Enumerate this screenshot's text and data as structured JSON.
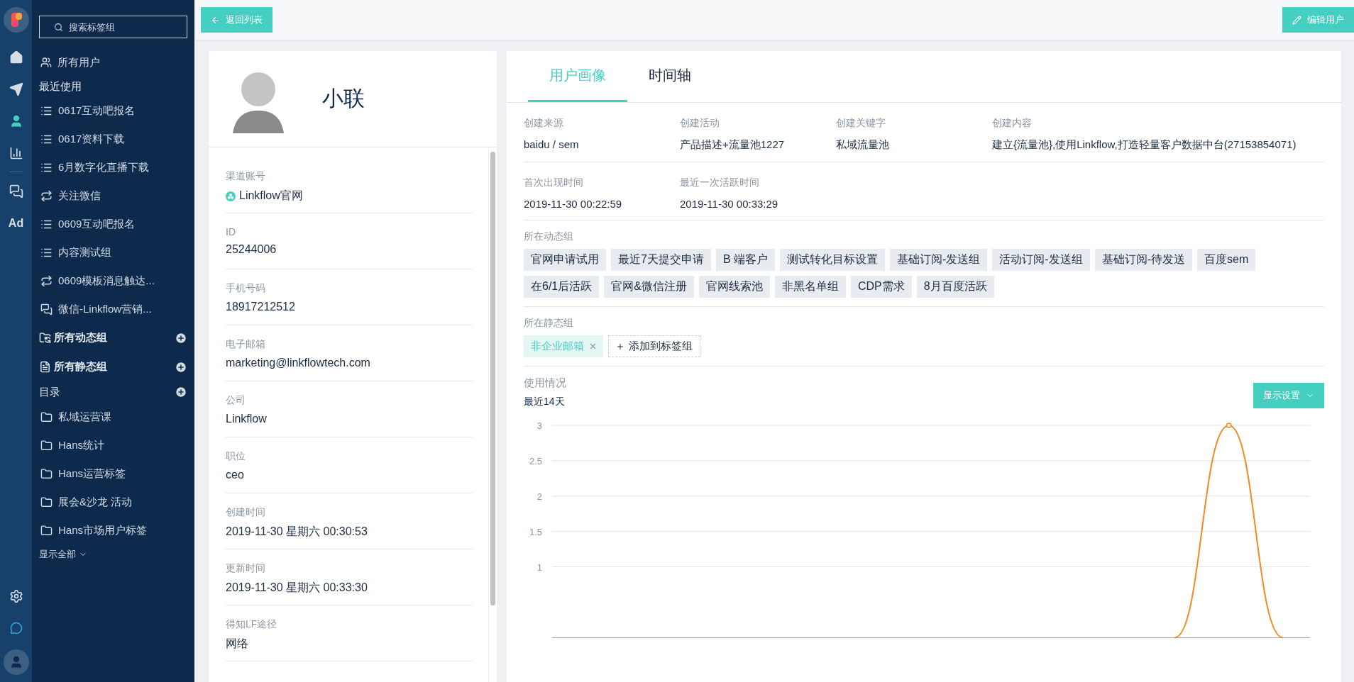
{
  "rail": [
    {
      "kind": "home",
      "selected": false
    },
    {
      "kind": "send",
      "selected": false
    },
    {
      "kind": "user",
      "selected": true
    },
    {
      "kind": "chart",
      "selected": false
    },
    {
      "kind": "wechat",
      "selected": false
    },
    {
      "kind": "ad",
      "label": "Ad",
      "selected": false
    }
  ],
  "rail_bottom": [
    {
      "kind": "settings"
    },
    {
      "kind": "chat"
    },
    {
      "kind": "avatar"
    }
  ],
  "nav": {
    "search": {
      "placeholder": "搜索标签组"
    },
    "all_users": "所有用户",
    "recent_title": "最近使用",
    "recent": [
      {
        "label": "0617互动吧报名",
        "kind": "list"
      },
      {
        "label": "0617资料下载",
        "kind": "list"
      },
      {
        "label": "6月数字化直播下载",
        "kind": "list"
      },
      {
        "label": "关注微信",
        "kind": "sync"
      },
      {
        "label": "0609互动吧报名",
        "kind": "list"
      },
      {
        "label": "内容测试组",
        "kind": "list"
      },
      {
        "label": "0609模板消息触达...",
        "kind": "sync"
      },
      {
        "label": "微信-Linkflow营销...",
        "kind": "wechat"
      }
    ],
    "groups": [
      {
        "label": "所有动态组",
        "kind": "dynamic"
      },
      {
        "label": "所有静态组",
        "kind": "static"
      }
    ],
    "catalog_title": "目录",
    "catalog": [
      "私域运营课",
      "Hans统计",
      "Hans运营标签",
      "展会&沙龙 活动",
      "Hans市场用户标签"
    ],
    "show_all": "显示全部"
  },
  "toolbar": {
    "back": "返回列表",
    "edit": "编辑用户"
  },
  "profile": {
    "name": "小联",
    "fields": [
      {
        "label": "渠道账号",
        "value": "Linkflow官网",
        "kind": "channel"
      },
      {
        "label": "ID",
        "value": "25244006",
        "kind": "text"
      },
      {
        "label": "手机号码",
        "value": "18917212512",
        "kind": "text"
      },
      {
        "label": "电子邮箱",
        "value": "marketing@linkflowtech.com",
        "kind": "text"
      },
      {
        "label": "公司",
        "value": "Linkflow",
        "kind": "text"
      },
      {
        "label": "职位",
        "value": "ceo",
        "kind": "text"
      },
      {
        "label": "创建时间",
        "value": "2019-11-30 星期六 00:30:53",
        "kind": "text"
      },
      {
        "label": "更新时间",
        "value": "2019-11-30 星期六 00:33:30",
        "kind": "text"
      },
      {
        "label": "得知LF途径",
        "value": "网络",
        "kind": "text"
      }
    ]
  },
  "tabs": [
    {
      "label": "用户画像",
      "selected": true
    },
    {
      "label": "时间轴",
      "selected": false
    }
  ],
  "info_rows": [
    [
      {
        "label": "创建来源",
        "value": "baidu / sem"
      },
      {
        "label": "创建活动",
        "value": "产品描述+流量池1227"
      },
      {
        "label": "创建关键字",
        "value": "私域流量池"
      },
      {
        "label": "创建内容",
        "value": "建立{流量池},使用Linkflow,打造轻量客户数据中台(27153854071)"
      }
    ],
    [
      {
        "label": "首次出现时间",
        "value": "2019-11-30 00:22:59"
      },
      {
        "label": "最近一次活跃时间",
        "value": "2019-11-30 00:33:29"
      }
    ]
  ],
  "dynamic_groups": {
    "title": "所在动态组",
    "tags": [
      "官网申请试用",
      "最近7天提交申请",
      "B 端客户",
      "测试转化目标设置",
      "基础订阅-发送组",
      "活动订阅-发送组",
      "基础订阅-待发送",
      "百度sem",
      "在6/1后活跃",
      "官网&微信注册",
      "官网线索池",
      "非黑名单组",
      "CDP需求",
      "8月百度活跃"
    ]
  },
  "static_groups": {
    "title": "所在静态组",
    "tags": [
      {
        "label": "非企业邮箱",
        "removable": true
      }
    ],
    "add": "添加到标签组"
  },
  "usage": {
    "title": "使用情况",
    "subtitle": "最近14天",
    "settings_button": "显示设置",
    "chart_data": {
      "type": "line",
      "series": [
        {
          "color": "#f5891f",
          "values": [
            null,
            null,
            null,
            null,
            null,
            null,
            null,
            null,
            null,
            null,
            null,
            0,
            3,
            0
          ]
        }
      ],
      "ylim": [
        0,
        3
      ],
      "yticks": [
        1,
        1.5,
        2,
        2.5,
        3
      ],
      "grid": true
    }
  }
}
